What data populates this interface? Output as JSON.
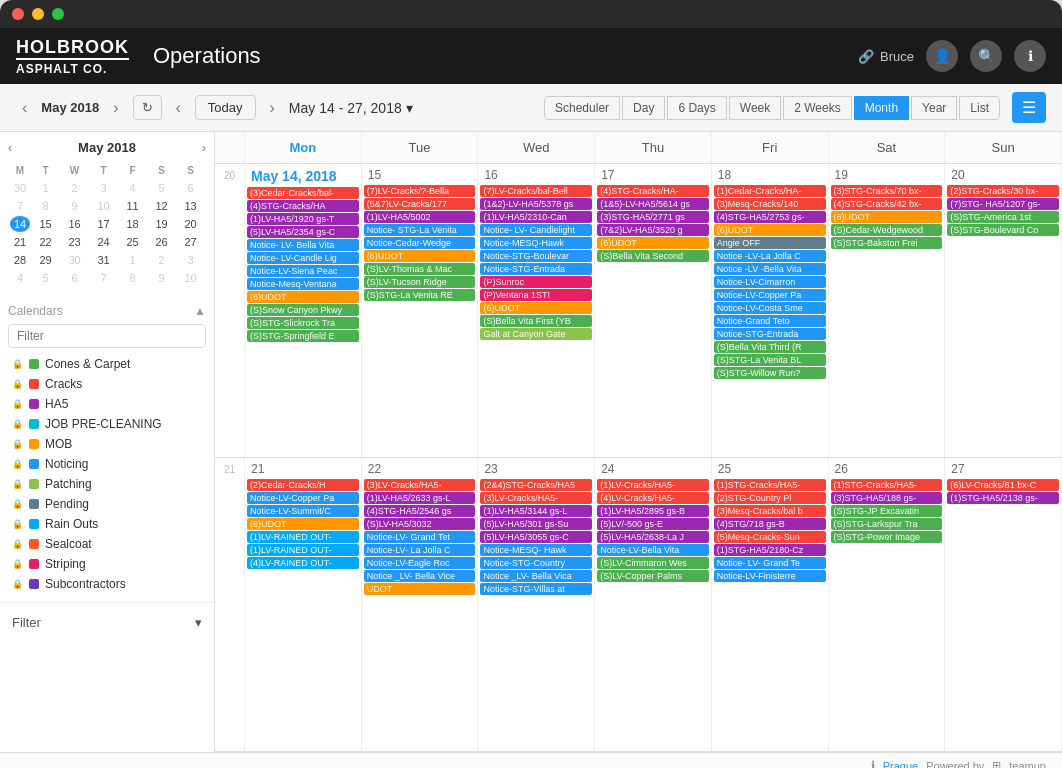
{
  "app": {
    "title": "Operations",
    "logo_top": "HOLBROOK",
    "logo_bottom": "ASPHALT CO."
  },
  "header": {
    "user_label": "Bruce",
    "link_icon": "🔗"
  },
  "toolbar": {
    "mini_prev": "‹",
    "mini_next": "›",
    "month_label": "May",
    "year_label": "2018",
    "refresh_icon": "↻",
    "nav_prev": "‹",
    "nav_next": "›",
    "today_label": "Today",
    "date_range": "May 14 - 27, 2018",
    "dropdown_icon": "▾",
    "views": [
      "Scheduler",
      "Day",
      "6 Days",
      "Week",
      "2 Weeks",
      "Month",
      "Year",
      "List"
    ],
    "active_view": "Month",
    "menu_icon": "☰"
  },
  "mini_calendar": {
    "month": "May",
    "year": "2018",
    "days_header": [
      "M",
      "T",
      "W",
      "T",
      "F",
      "S",
      "S"
    ],
    "weeks": [
      [
        30,
        1,
        2,
        3,
        4,
        5,
        6
      ],
      [
        7,
        8,
        9,
        10,
        11,
        12,
        13
      ],
      [
        14,
        15,
        16,
        17,
        18,
        19,
        20
      ],
      [
        21,
        22,
        23,
        24,
        25,
        26,
        27
      ],
      [
        28,
        29,
        30,
        31,
        1,
        2,
        3
      ],
      [
        4,
        5,
        6,
        7,
        8,
        9,
        10
      ]
    ],
    "today": 14,
    "other_month_start": [
      30
    ],
    "other_month_end": [
      1,
      2,
      3,
      4,
      5,
      6,
      7,
      8,
      9,
      10
    ]
  },
  "sidebar": {
    "calendars_label": "Calendars",
    "filter_placeholder": "Filter",
    "items": [
      {
        "label": "Cones & Carpet",
        "color": "#4CAF50",
        "locked": true
      },
      {
        "label": "Cracks",
        "color": "#F44336",
        "locked": true
      },
      {
        "label": "HA5",
        "color": "#9C27B0",
        "locked": true
      },
      {
        "label": "JOB PRE-CLEANING",
        "color": "#00BCD4",
        "locked": true
      },
      {
        "label": "MOB",
        "color": "#FF9800",
        "locked": true
      },
      {
        "label": "Noticing",
        "color": "#2196F3",
        "locked": true
      },
      {
        "label": "Patching",
        "color": "#8BC34A",
        "locked": true
      },
      {
        "label": "Pending",
        "color": "#607D8B",
        "locked": true
      },
      {
        "label": "Rain Outs",
        "color": "#03A9F4",
        "locked": true
      },
      {
        "label": "Sealcoat",
        "color": "#FF5722",
        "locked": true
      },
      {
        "label": "Striping",
        "color": "#E91E63",
        "locked": true
      },
      {
        "label": "Subcontractors",
        "color": "#673AB7",
        "locked": true
      }
    ],
    "filter_btn": "Filter"
  },
  "grid": {
    "day_headers": [
      "Mon",
      "Tue",
      "Wed",
      "Thu",
      "Fri",
      "Sat",
      "Sun"
    ],
    "week1_num": "20",
    "week2_num": "21",
    "week1_days": [
      "14",
      "15",
      "16",
      "17",
      "18",
      "19",
      "20"
    ],
    "week2_days": [
      "21",
      "22",
      "23",
      "24",
      "25",
      "26",
      "27"
    ],
    "week1_today": "14"
  },
  "week1_events": {
    "mon": [
      {
        "text": "(3)Cedar-Cracks/bal-",
        "color": "#F44336"
      },
      {
        "text": "(4)STG-Cracks/HA",
        "color": "#9C27B0"
      },
      {
        "text": "(1)LV-HA5/1920 gs-T",
        "color": "#9C27B0"
      },
      {
        "text": "(5)LV-HA5/2354 gs-C",
        "color": "#9C27B0"
      },
      {
        "text": "Notice- LV- Bella Vita",
        "color": "#2196F3"
      },
      {
        "text": "Notice- LV-Candle Lig",
        "color": "#2196F3"
      },
      {
        "text": "Notice-LV-Siena Peac",
        "color": "#2196F3"
      },
      {
        "text": "Notice-Mesq-Ventana",
        "color": "#2196F3"
      },
      {
        "text": "(6)UDOT",
        "color": "#FF9800"
      },
      {
        "text": "(S)Snow Canyon Pkwy",
        "color": "#4CAF50"
      },
      {
        "text": "(S)STG-Slickrock Tra",
        "color": "#4CAF50"
      },
      {
        "text": "(S)STG-Springfield E",
        "color": "#4CAF50"
      }
    ],
    "tue": [
      {
        "text": "(7)LV-Cracks/?-Bella",
        "color": "#F44336"
      },
      {
        "text": "(5&7)LV-Cracks/177",
        "color": "#F44336"
      },
      {
        "text": "(1)LV-HA5/5002",
        "color": "#9C27B0"
      },
      {
        "text": "Notice- STG-La Venita",
        "color": "#2196F3"
      },
      {
        "text": "Notice-Cedar-Wedge",
        "color": "#2196F3"
      },
      {
        "text": "(6)UDOT",
        "color": "#FF9800"
      },
      {
        "text": "(S)LV-Thomas & Mac",
        "color": "#4CAF50"
      },
      {
        "text": "(S)LV-Tucson Ridge",
        "color": "#4CAF50"
      },
      {
        "text": "(S)STG-La Venita RE",
        "color": "#4CAF50"
      }
    ],
    "wed": [
      {
        "text": "(7)LV-Cracks/bal-Bell",
        "color": "#F44336"
      },
      {
        "text": "(1&2)-LV-HA5/5378 gs",
        "color": "#9C27B0"
      },
      {
        "text": "(1)LV-HA5/2310-Can",
        "color": "#9C27B0"
      },
      {
        "text": "Notice- LV- Candlelight",
        "color": "#2196F3"
      },
      {
        "text": "Notice-MESQ-Hawk",
        "color": "#2196F3"
      },
      {
        "text": "Notice-STG-Boulevar",
        "color": "#2196F3"
      },
      {
        "text": "Notice-STG-Entrada",
        "color": "#2196F3"
      },
      {
        "text": "(P)Sunroc",
        "color": "#E91E63"
      },
      {
        "text": "(P)Ventana 1ST!",
        "color": "#E91E63"
      },
      {
        "text": "(6)UDOT",
        "color": "#FF9800"
      },
      {
        "text": "(S)Bella Vita First (YB",
        "color": "#4CAF50"
      },
      {
        "text": "Galt at Canyon Gate",
        "color": "#8BC34A"
      }
    ],
    "thu": [
      {
        "text": "(4)STG-Cracks/HA-",
        "color": "#F44336"
      },
      {
        "text": "(1&5)-LV-HA5/5614 gs",
        "color": "#9C27B0"
      },
      {
        "text": "(3)STG-HA5/2771 gs",
        "color": "#9C27B0"
      },
      {
        "text": "(7&2)LV-HA5/3520 g",
        "color": "#9C27B0"
      },
      {
        "text": "(6)UDOT",
        "color": "#FF9800"
      },
      {
        "text": "(S)Bella Vita Second",
        "color": "#4CAF50"
      }
    ],
    "fri": [
      {
        "text": "(1)Cedar-Cracks/HA-",
        "color": "#F44336"
      },
      {
        "text": "(3)Mesq-Cracks/140",
        "color": "#F44336"
      },
      {
        "text": "(4)STG-HA5/2753 gs-",
        "color": "#9C27B0"
      },
      {
        "text": "(6)UDOT",
        "color": "#FF9800"
      },
      {
        "text": "Angie OFF",
        "color": "#607D8B"
      },
      {
        "text": "Notice -LV-La Jolla C",
        "color": "#2196F3"
      },
      {
        "text": "Notice -LV -Bella Vita",
        "color": "#2196F3"
      },
      {
        "text": "Notice-LV-Cimarron",
        "color": "#2196F3"
      },
      {
        "text": "Notice-LV-Copper Pa",
        "color": "#2196F3"
      },
      {
        "text": "Notice-LV-Costa Sme",
        "color": "#2196F3"
      },
      {
        "text": "Notice-Grand Teto",
        "color": "#2196F3"
      },
      {
        "text": "Notice-STG-Entrada",
        "color": "#2196F3"
      },
      {
        "text": "(6)UDOT",
        "color": "#FF9800"
      },
      {
        "text": "(S)Bella Vita Third (R",
        "color": "#4CAF50"
      },
      {
        "text": "(S)STG-La Venita BL",
        "color": "#4CAF50"
      },
      {
        "text": "(S)STG-Willow Run?",
        "color": "#4CAF50"
      }
    ],
    "sat": [
      {
        "text": "(3)STG-Cracks/70 bx-",
        "color": "#F44336"
      },
      {
        "text": "(4)STG-Cracks/42 bx-",
        "color": "#F44336"
      },
      {
        "text": "(6)UDOT",
        "color": "#FF9800"
      },
      {
        "text": "(S)Cedar-Wedgewood",
        "color": "#4CAF50"
      },
      {
        "text": "(S)STG-Bakston Frei",
        "color": "#4CAF50"
      }
    ],
    "sun": [
      {
        "text": "(2)STG-Cracks/30 bx-",
        "color": "#F44336"
      },
      {
        "text": "(7)STG- HA5/1207 gs-",
        "color": "#9C27B0"
      },
      {
        "text": "(S)STG-America 1st",
        "color": "#4CAF50"
      },
      {
        "text": "(S)STG-Boulevard Co",
        "color": "#4CAF50"
      }
    ]
  },
  "week2_events": {
    "mon": [
      {
        "text": "(2)Cedar-Cracks/H",
        "color": "#F44336"
      },
      {
        "text": "Notice-LV-Copper Pa",
        "color": "#2196F3"
      },
      {
        "text": "Notice-LV-Summit/C",
        "color": "#2196F3"
      },
      {
        "text": "(6)UDOT",
        "color": "#FF9800"
      },
      {
        "text": "(1)LV-RAINED OUT-",
        "color": "#03A9F4"
      },
      {
        "text": "(1)LV-RAINED OUT-",
        "color": "#03A9F4"
      },
      {
        "text": "(4)LV-RAINED OUT-",
        "color": "#03A9F4"
      }
    ],
    "tue": [
      {
        "text": "(3)LV-Cracks/HA5-",
        "color": "#F44336"
      },
      {
        "text": "(1)LV-HA5/2633 gs-L",
        "color": "#9C27B0"
      },
      {
        "text": "(4)STG-HA5/2546 gs",
        "color": "#9C27B0"
      },
      {
        "text": "(S)LV-HA5/3032",
        "color": "#9C27B0"
      },
      {
        "text": "Notice-LV- Grand Tet",
        "color": "#2196F3"
      },
      {
        "text": "Notice-LV- La Jolla C",
        "color": "#2196F3"
      },
      {
        "text": "Notice-LV-Eagle Roc",
        "color": "#2196F3"
      },
      {
        "text": "Notice_LV- Bella Vice",
        "color": "#2196F3"
      },
      {
        "text": "UDOT",
        "color": "#FF9800"
      }
    ],
    "wed": [
      {
        "text": "(2&4)STG-Cracks/HA5",
        "color": "#F44336"
      },
      {
        "text": "(3)LV-Cracks/HA5-",
        "color": "#F44336"
      },
      {
        "text": "(1)LV-HA5/3144 gs-L",
        "color": "#9C27B0"
      },
      {
        "text": "(5)LV-HA5/301 gs-Su",
        "color": "#9C27B0"
      },
      {
        "text": "(5)LV-HA5/3055 gs-C",
        "color": "#9C27B0"
      },
      {
        "text": "Notice-MESQ- Hawk",
        "color": "#2196F3"
      },
      {
        "text": "Notice-STG-Country",
        "color": "#2196F3"
      },
      {
        "text": "Notice _LV- Bella Vica",
        "color": "#2196F3"
      },
      {
        "text": "Notice-STG-Villas at",
        "color": "#2196F3"
      }
    ],
    "thu": [
      {
        "text": "(1)LV-Cracks/HA5-",
        "color": "#F44336"
      },
      {
        "text": "(4)LV-Cracks/HA5-",
        "color": "#F44336"
      },
      {
        "text": "(1)LV-HA5/2895 gs-B",
        "color": "#9C27B0"
      },
      {
        "text": "(5)LV/-500 gs-E",
        "color": "#9C27B0"
      },
      {
        "text": "(5)LV-HA5/2638-La J",
        "color": "#9C27B0"
      },
      {
        "text": "Notice-LV-Bella Vita",
        "color": "#2196F3"
      },
      {
        "text": "(S)LV-Cimmaron Wes",
        "color": "#4CAF50"
      },
      {
        "text": "(S)LV-Copper Palms",
        "color": "#4CAF50"
      }
    ],
    "fri": [
      {
        "text": "(1)STG-Cracks/HA5-",
        "color": "#F44336"
      },
      {
        "text": "(2)STG-Country Pl",
        "color": "#F44336"
      },
      {
        "text": "(3)Mesq-Cracks/bal b",
        "color": "#F44336"
      },
      {
        "text": "(4)STG/718 gs-B",
        "color": "#9C27B0"
      },
      {
        "text": "(5)Mesq-Cracks-Sun",
        "color": "#F44336"
      },
      {
        "text": "(1)STG-HA5/2180-Cz",
        "color": "#9C27B0"
      },
      {
        "text": "Notice- LV- Grand Te",
        "color": "#2196F3"
      },
      {
        "text": "Notice-LV-Finisterre",
        "color": "#2196F3"
      }
    ],
    "sat": [
      {
        "text": "(1)STG-Cracks/HA5-",
        "color": "#F44336"
      },
      {
        "text": "(3)STG-HA5/188 gs-",
        "color": "#9C27B0"
      },
      {
        "text": "(S)STG-JP Excavatin",
        "color": "#4CAF50"
      },
      {
        "text": "(S)STG-Larkspur Tra",
        "color": "#4CAF50"
      },
      {
        "text": "(S)STG-Power Image",
        "color": "#4CAF50"
      }
    ],
    "sun": [
      {
        "text": "(6)LV-Cracks/61 bx-C",
        "color": "#F44336"
      },
      {
        "text": "(1)STG-HA5/2138 gs-",
        "color": "#9C27B0"
      }
    ]
  },
  "footer": {
    "prague_label": "Prague",
    "powered_label": "Powered by",
    "teamup_label": "teamup"
  }
}
